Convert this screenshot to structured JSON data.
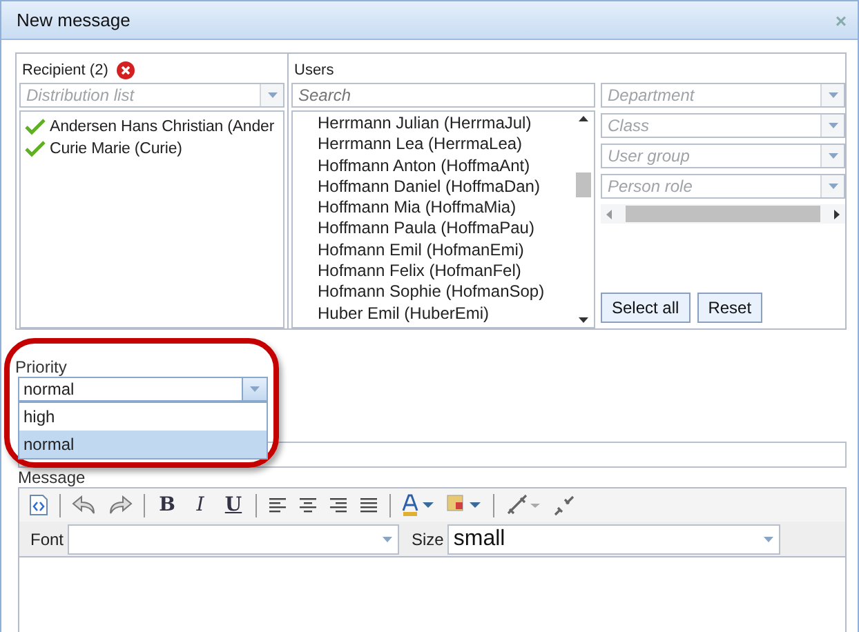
{
  "window": {
    "title": "New message",
    "close": "×"
  },
  "recipients": {
    "label": "Recipient (2)",
    "distribution_list": {
      "placeholder": "Distribution list"
    },
    "items": [
      {
        "name": "Andersen Hans Christian (Ander",
        "checked": true
      },
      {
        "name": "Curie Marie (Curie)",
        "checked": true
      }
    ]
  },
  "users": {
    "label": "Users",
    "search": {
      "placeholder": "Search"
    },
    "items": [
      "Herrmann Julian (HerrmaJul)",
      "Herrmann Lea (HerrmaLea)",
      "Hoffmann Anton (HoffmaAnt)",
      "Hoffmann Daniel (HoffmaDan)",
      "Hoffmann Mia (HoffmaMia)",
      "Hoffmann Paula (HoffmaPau)",
      "Hofmann Emil (HofmanEmi)",
      "Hofmann Felix (HofmanFel)",
      "Hofmann Sophie (HofmanSop)",
      "Huber Emil (HuberEmi)"
    ]
  },
  "filters": [
    {
      "placeholder": "Department"
    },
    {
      "placeholder": "Class"
    },
    {
      "placeholder": "User group"
    },
    {
      "placeholder": "Person role"
    }
  ],
  "buttons": [
    "Select all",
    "Reset"
  ],
  "priority": {
    "label": "Priority",
    "value": "normal",
    "options": [
      {
        "label": "high",
        "selected": false
      },
      {
        "label": "normal",
        "selected": true
      }
    ]
  },
  "message": {
    "label": "Message",
    "format_buttons": [
      "B",
      "I",
      "U"
    ],
    "font": {
      "label": "Font"
    },
    "size": {
      "label": "Size",
      "value": "small"
    }
  }
}
